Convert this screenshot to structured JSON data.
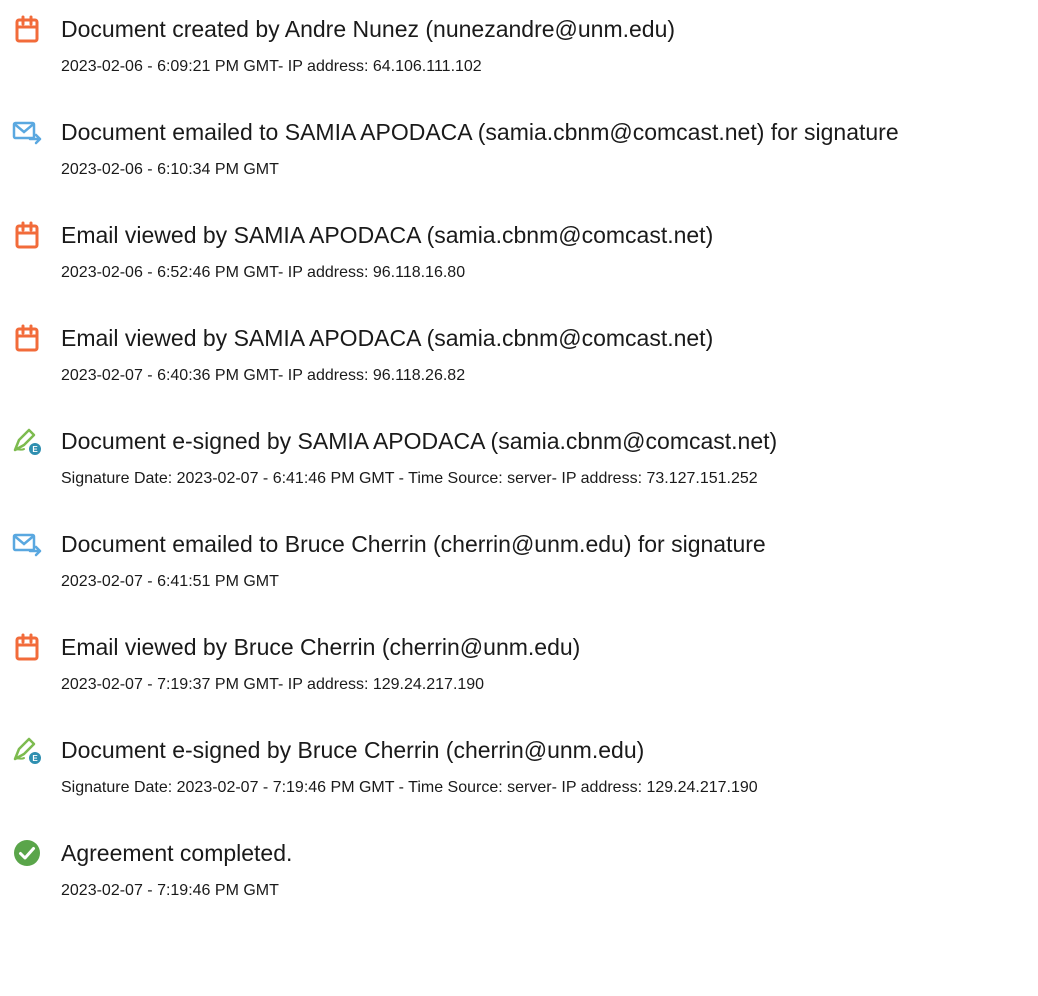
{
  "entries": [
    {
      "icon": "document-created-icon",
      "title": "Document created by Andre Nunez (nunezandre@unm.edu)",
      "detail": "2023-02-06 - 6:09:21 PM GMT- IP address: 64.106.111.102"
    },
    {
      "icon": "email-sent-icon",
      "title": "Document emailed to SAMIA APODACA (samia.cbnm@comcast.net) for signature",
      "detail": "2023-02-06 - 6:10:34 PM GMT"
    },
    {
      "icon": "document-viewed-icon",
      "title": "Email viewed by SAMIA APODACA (samia.cbnm@comcast.net)",
      "detail": "2023-02-06 - 6:52:46 PM GMT- IP address: 96.118.16.80"
    },
    {
      "icon": "document-viewed-icon",
      "title": "Email viewed by SAMIA APODACA (samia.cbnm@comcast.net)",
      "detail": "2023-02-07 - 6:40:36 PM GMT- IP address: 96.118.26.82"
    },
    {
      "icon": "e-sign-pen-icon",
      "title": "Document e-signed by SAMIA APODACA (samia.cbnm@comcast.net)",
      "detail": "Signature Date: 2023-02-07 - 6:41:46 PM GMT - Time Source: server- IP address: 73.127.151.252"
    },
    {
      "icon": "email-sent-icon",
      "title": "Document emailed to Bruce Cherrin (cherrin@unm.edu) for signature",
      "detail": "2023-02-07 - 6:41:51 PM GMT"
    },
    {
      "icon": "document-viewed-icon",
      "title": "Email viewed by Bruce Cherrin (cherrin@unm.edu)",
      "detail": "2023-02-07 - 7:19:37 PM GMT- IP address: 129.24.217.190"
    },
    {
      "icon": "e-sign-pen-icon",
      "title": "Document e-signed by Bruce Cherrin (cherrin@unm.edu)",
      "detail": "Signature Date: 2023-02-07 - 7:19:46 PM GMT - Time Source: server- IP address: 129.24.217.190"
    },
    {
      "icon": "completed-check-icon",
      "title": "Agreement completed.",
      "detail": "2023-02-07 - 7:19:46 PM GMT"
    }
  ],
  "colors": {
    "document_icon": "#f26b3a",
    "email_icon": "#5aa8e0",
    "pen_icon": "#7dbb4f",
    "check_icon": "#5aa54a",
    "text": "#1a1a1a"
  }
}
